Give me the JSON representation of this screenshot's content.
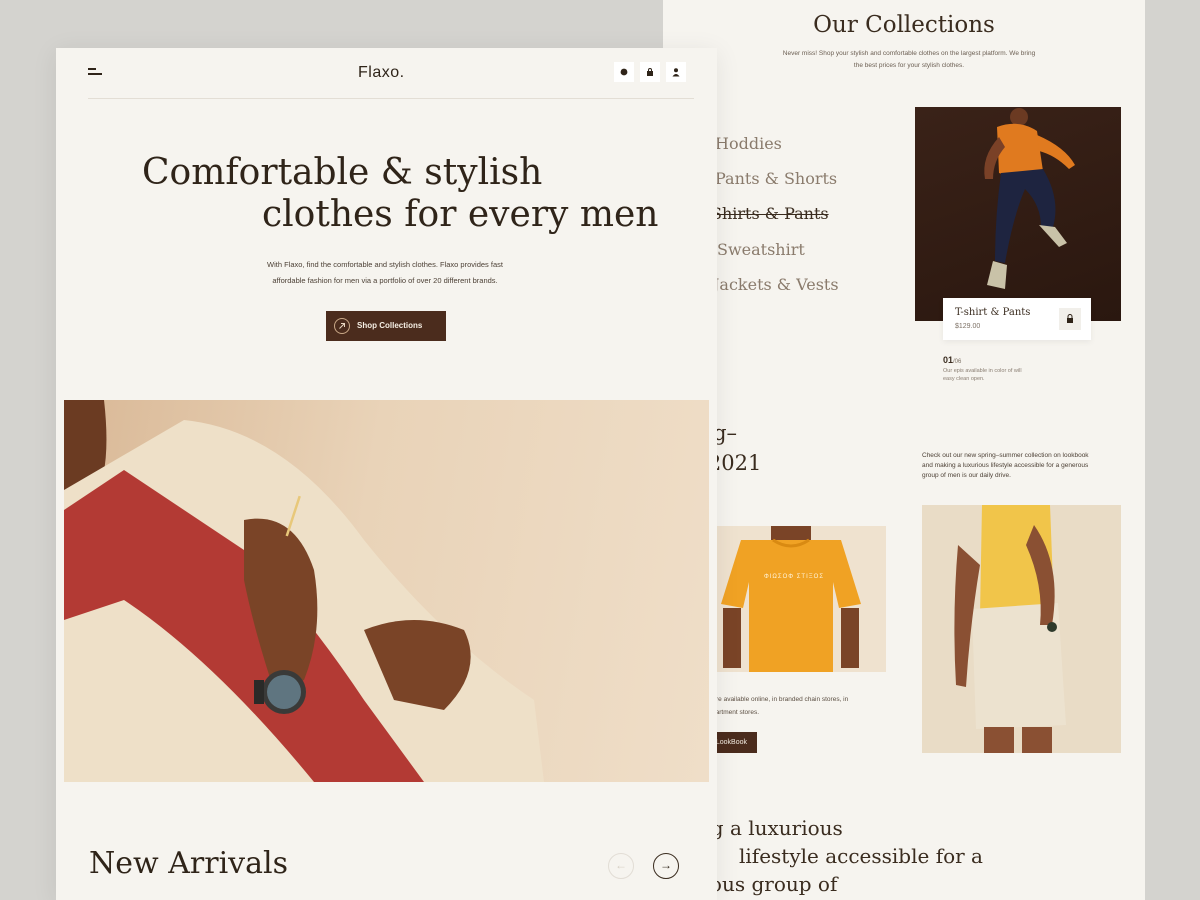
{
  "collections": {
    "title": "Our Collections",
    "subtitle": "Never miss! Shop your stylish and comfortable clothes on the largest platform. We bring the best prices for your stylish clothes.",
    "items": [
      "Hoddies",
      "Pants & Shorts",
      "Shirts & Pants",
      "Sweatshirt",
      "Jackets & Vests"
    ],
    "active_index": 2,
    "product": {
      "name": "T-shirt & Pants",
      "price": "$129.00"
    },
    "counter": {
      "current": "01",
      "total": "/06"
    },
    "counter_desc": "Our epis available in color of will easy clean open."
  },
  "spring": {
    "title_line1": "Spring–",
    "title_line2": "Summer 2021",
    "desc": "Check out our new spring–summer collection on lookbook and making a luxurious lifestyle accessible for a generous group of men is our daily drive.",
    "store_text": "Our products are available online, in branded chain stores, in shops and department stores.",
    "lookbook_label": "LookBook",
    "tee_print": "ΦΙΩΣΟΦ ΣΤΙΞΟΣ"
  },
  "statement": {
    "line1": "Making a luxurious",
    "line2": "lifestyle accessible for a",
    "line3": "generous group of"
  },
  "front": {
    "logo": "Flaxo.",
    "hero_line1": "Comfortable & stylish",
    "hero_line2": "clothes for every men",
    "hero_desc": "With Flaxo, find the comfortable and stylish clothes. Flaxo provides fast affordable fashion for men via a portfolio of over 20 different brands.",
    "shop_label": "Shop Collections",
    "arrivals_title": "New Arrivals",
    "prev_arrow": "←",
    "next_arrow": "→"
  },
  "icons": {
    "menu": "menu-icon",
    "search": "search-icon",
    "cart": "bag-icon",
    "profile": "user-icon",
    "shop": "arrow-up-right-icon"
  },
  "colors": {
    "accent": "#4b2c1d",
    "page": "#f6f4ef",
    "backdrop": "#d4d3cf",
    "text": "#2f2419"
  }
}
